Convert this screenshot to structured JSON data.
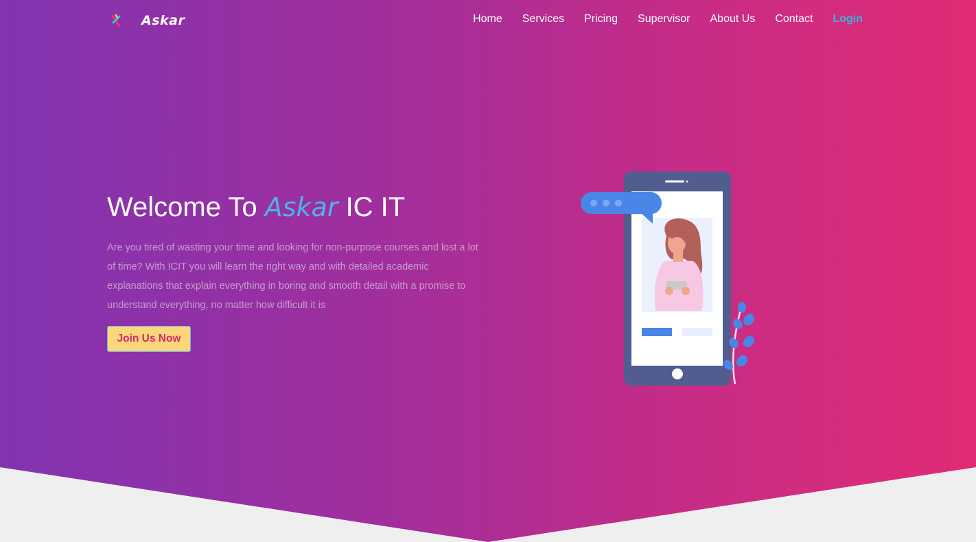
{
  "brand": {
    "name": "Askar",
    "logo_icon": "askar-logo-icon"
  },
  "nav": {
    "items": [
      {
        "label": "Home"
      },
      {
        "label": "Services"
      },
      {
        "label": "Pricing"
      },
      {
        "label": "Supervisor"
      },
      {
        "label": "About Us"
      },
      {
        "label": "Contact"
      }
    ],
    "login_label": "Login"
  },
  "hero": {
    "title_prefix": "Welcome To ",
    "title_accent": "Askar",
    "title_suffix": " IC IT",
    "description": "Are you tired of wasting your time and looking for non-purpose courses and lost a lot of time? With ICIT you will learn the right way and with detailed academic explanations that explain everything in boring and smooth detail with a promise to understand everything, no matter how difficult it is",
    "cta_label": "Join Us Now",
    "illustration": "woman-with-phone-illustration"
  },
  "colors": {
    "gradient_start": "#8134b1",
    "gradient_end": "#e12b75",
    "accent": "#4cb3ea",
    "login": "#3eb1e4",
    "cta_background": "#fcd67a",
    "cta_text": "#d32b6e",
    "section_background": "#efefef"
  }
}
